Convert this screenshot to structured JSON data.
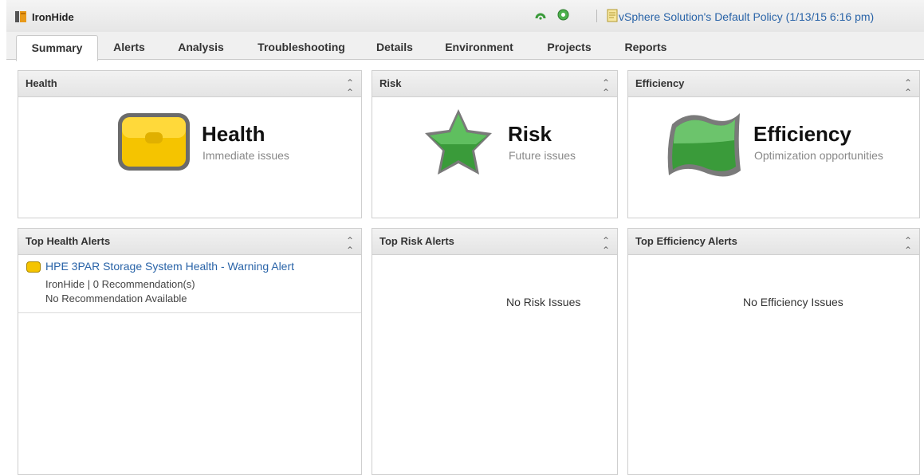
{
  "app": {
    "title": "IronHide"
  },
  "policy": {
    "label": "vSphere Solution's Default Policy (1/13/15 6:16 pm)"
  },
  "tabs": [
    "Summary",
    "Alerts",
    "Analysis",
    "Troubleshooting",
    "Details",
    "Environment",
    "Projects",
    "Reports"
  ],
  "active_tab": "Summary",
  "badges": {
    "health": {
      "title": "Health",
      "panel_title": "Health",
      "subtitle": "Immediate issues",
      "color": "#f5c400"
    },
    "risk": {
      "title": "Risk",
      "panel_title": "Risk",
      "subtitle": "Future issues",
      "color": "#3a9b3a"
    },
    "efficiency": {
      "title": "Efficiency",
      "panel_title": "Efficiency",
      "subtitle": "Optimization opportunities",
      "color": "#3a9b3a"
    }
  },
  "alerts": {
    "health": {
      "panel_title": "Top Health Alerts",
      "items": [
        {
          "name": "HPE 3PAR Storage System Health - Warning Alert",
          "meta": "IronHide | 0 Recommendation(s)",
          "recommendation": "No Recommendation Available"
        }
      ]
    },
    "risk": {
      "panel_title": "Top Risk Alerts",
      "empty": "No Risk Issues"
    },
    "efficiency": {
      "panel_title": "Top Efficiency Alerts",
      "empty": "No Efficiency Issues"
    }
  }
}
